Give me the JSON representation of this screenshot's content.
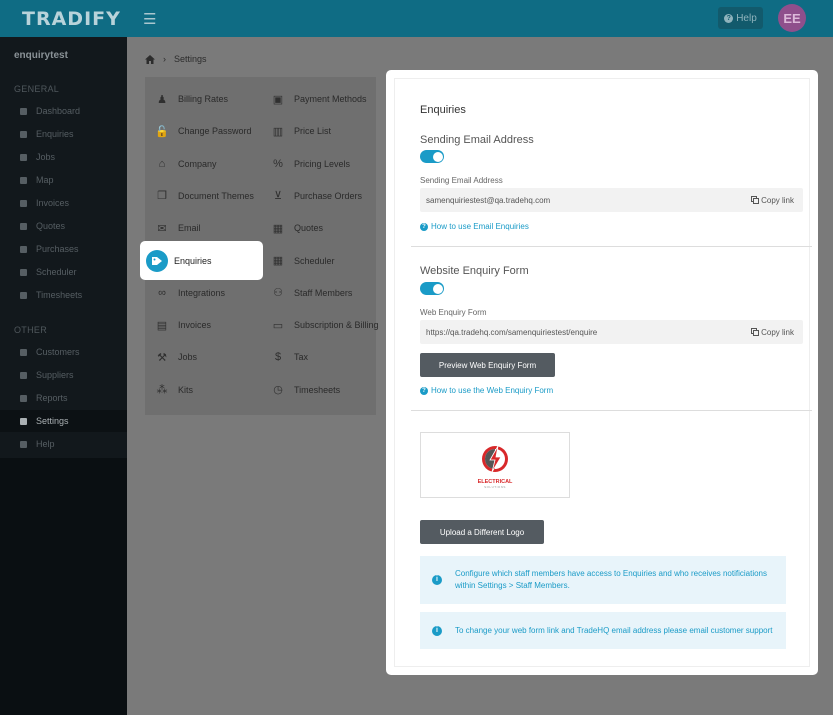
{
  "app": {
    "logo": "TRADIFY",
    "menu_icon": "☰",
    "help_label": "Help",
    "help_glyph": "?",
    "avatar_initials": "EE"
  },
  "sidebar": {
    "user": "enquirytest",
    "general_label": "GENERAL",
    "other_label": "OTHER",
    "general": [
      {
        "label": "Dashboard",
        "icon": "dashboard-icon"
      },
      {
        "label": "Enquiries",
        "icon": "tag-icon"
      },
      {
        "label": "Jobs",
        "icon": "hammer-icon"
      },
      {
        "label": "Map",
        "icon": "map-pin-icon"
      },
      {
        "label": "Invoices",
        "icon": "invoice-icon"
      },
      {
        "label": "Quotes",
        "icon": "calculator-icon"
      },
      {
        "label": "Purchases",
        "icon": "cart-icon"
      },
      {
        "label": "Scheduler",
        "icon": "calendar-icon"
      },
      {
        "label": "Timesheets",
        "icon": "clock-icon"
      }
    ],
    "other": [
      {
        "label": "Customers",
        "icon": "users-icon"
      },
      {
        "label": "Suppliers",
        "icon": "truck-icon"
      },
      {
        "label": "Reports",
        "icon": "chart-icon"
      },
      {
        "label": "Settings",
        "icon": "gear-icon",
        "active": true
      },
      {
        "label": "Help",
        "icon": "question-icon"
      }
    ]
  },
  "breadcrumb": {
    "home_icon": "home-icon",
    "separator": "›",
    "current": "Settings"
  },
  "settings_menu": {
    "left": [
      {
        "label": "Billing Rates",
        "icon": "person-icon"
      },
      {
        "label": "Change Password",
        "icon": "lock-icon"
      },
      {
        "label": "Company",
        "icon": "home-icon"
      },
      {
        "label": "Document Themes",
        "icon": "copy-icon"
      },
      {
        "label": "Email",
        "icon": "envelope-icon"
      },
      {
        "label": "Enquiries",
        "icon": "tags-icon",
        "selected": true
      },
      {
        "label": "Integrations",
        "icon": "link-icon"
      },
      {
        "label": "Invoices",
        "icon": "file-icon"
      },
      {
        "label": "Jobs",
        "icon": "hammer-icon"
      },
      {
        "label": "Kits",
        "icon": "cubes-icon"
      }
    ],
    "right": [
      {
        "label": "Payment Methods",
        "icon": "money-icon"
      },
      {
        "label": "Price List",
        "icon": "book-icon"
      },
      {
        "label": "Pricing Levels",
        "icon": "percent-icon"
      },
      {
        "label": "Purchase Orders",
        "icon": "cart-icon"
      },
      {
        "label": "Quotes",
        "icon": "calculator-icon"
      },
      {
        "label": "Scheduler",
        "icon": "calendar-icon"
      },
      {
        "label": "Staff Members",
        "icon": "users-icon"
      },
      {
        "label": "Subscription & Billing",
        "icon": "credit-card-icon"
      },
      {
        "label": "Tax",
        "icon": "dollar-icon"
      },
      {
        "label": "Timesheets",
        "icon": "clock-icon"
      }
    ]
  },
  "enquiries": {
    "title": "Enquiries",
    "email_section": {
      "heading": "Sending Email Address",
      "toggle_on": true,
      "field_label": "Sending Email Address",
      "field_value": "samenquiriestest@qa.tradehq.com",
      "copy_label": "Copy link",
      "help_link": "How to use Email Enquiries"
    },
    "web_section": {
      "heading": "Website Enquiry Form",
      "toggle_on": true,
      "field_label": "Web Enquiry Form",
      "field_value": "https://qa.tradehq.com/samenquiriestest/enquire",
      "copy_label": "Copy link",
      "preview_button": "Preview Web Enquiry Form",
      "help_link": "How to use the Web Enquiry Form"
    },
    "logo_text": "ELECTRICAL",
    "logo_subtext": "SOLUTIONS",
    "upload_button": "Upload a Different Logo",
    "info1": "Configure which staff members have access to Enquiries and who receives notificiations within Settings > Staff Members.",
    "info2": "To change your web form link and TradeHQ email address please email customer support",
    "info_glyph": "i"
  },
  "colors": {
    "accent": "#1a9bc7",
    "topbar": "#0f6c84",
    "avatar": "#8f4f8c",
    "logo_red": "#d8282a"
  }
}
